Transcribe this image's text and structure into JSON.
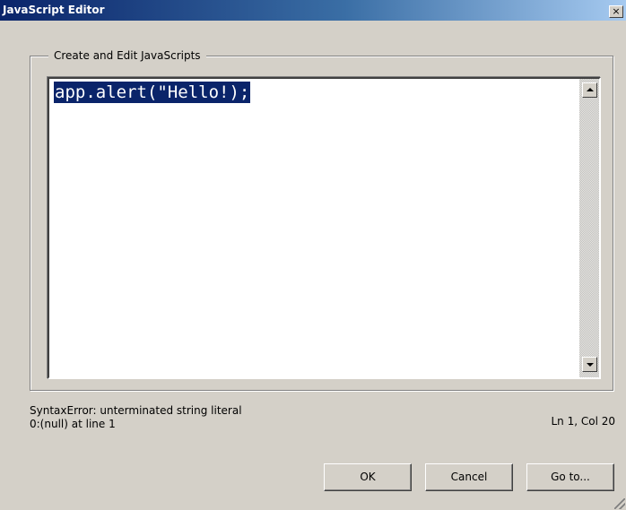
{
  "window": {
    "title": "JavaScript Editor",
    "close_glyph": "×"
  },
  "group": {
    "legend": "Create and Edit JavaScripts"
  },
  "editor": {
    "code": "app.alert(\"Hello!);"
  },
  "status": {
    "error_line1": "SyntaxError: unterminated string literal",
    "error_line2": "0:(null) at line 1",
    "cursor_position": "Ln 1, Col 20"
  },
  "buttons": {
    "ok": "OK",
    "cancel": "Cancel",
    "goto": "Go to..."
  },
  "icons": {
    "close": "close-icon",
    "scroll_up": "scroll-up-arrow-icon",
    "scroll_down": "scroll-down-arrow-icon",
    "resize_grip": "resize-grip-icon"
  }
}
